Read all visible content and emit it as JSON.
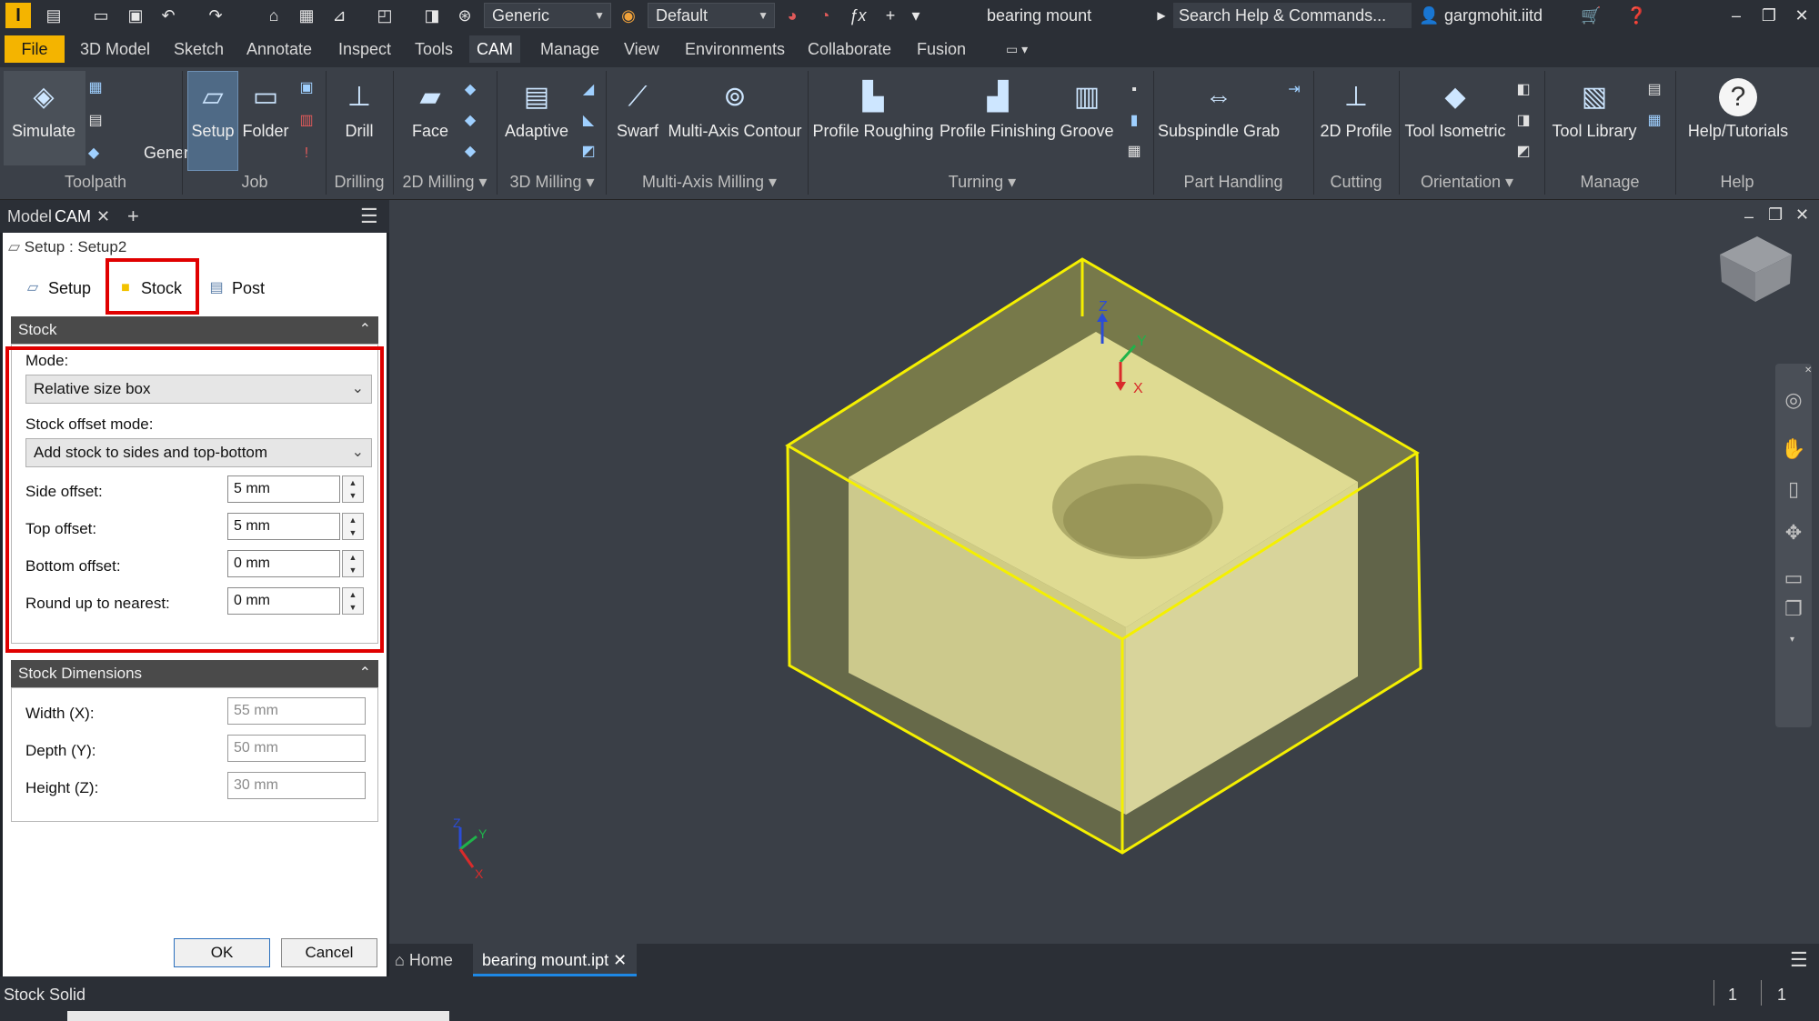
{
  "app": {
    "logo_letter": "I",
    "visual_style": "Generic",
    "appearance": "Default",
    "document_title": "bearing mount",
    "search_placeholder": "Search Help & Commands...",
    "user": "gargmohit.iitd"
  },
  "menu": {
    "file": "File",
    "tabs": [
      "3D Model",
      "Sketch",
      "Annotate",
      "Inspect",
      "Tools",
      "CAM",
      "Manage",
      "View",
      "Environments",
      "Collaborate",
      "Fusion"
    ],
    "active_tab": "CAM"
  },
  "ribbon": {
    "buttons": {
      "simulate": "Simulate",
      "generate": "Generate",
      "setup": "Setup",
      "folder": "Folder",
      "drill": "Drill",
      "face": "Face",
      "adaptive": "Adaptive",
      "swarf": "Swarf",
      "multi_axis_contour": "Multi-Axis Contour",
      "profile_roughing": "Profile Roughing",
      "profile_finishing": "Profile Finishing",
      "groove": "Groove",
      "subspindle_grab": "Subspindle Grab",
      "profile_2d": "2D Profile",
      "tool_isometric": "Tool Isometric",
      "tool_library": "Tool Library",
      "help_tutorials": "Help/Tutorials"
    },
    "groups": {
      "toolpath": "Toolpath",
      "job": "Job",
      "drilling": "Drilling",
      "milling_2d": "2D Milling",
      "milling_3d": "3D Milling",
      "multi_axis": "Multi-Axis Milling",
      "turning": "Turning",
      "part_handling": "Part Handling",
      "cutting": "Cutting",
      "orientation": "Orientation",
      "manage": "Manage",
      "help": "Help"
    }
  },
  "panel": {
    "tab_model": "Model",
    "tab_cam": "CAM"
  },
  "dialog": {
    "title": "Setup : Setup2",
    "tabs": {
      "setup": "Setup",
      "stock": "Stock",
      "post_process": "Post Process"
    },
    "stock_section": {
      "header": "Stock",
      "mode_label": "Mode:",
      "mode_value": "Relative size box",
      "offset_mode_label": "Stock offset mode:",
      "offset_mode_value": "Add stock to sides and top-bottom",
      "side_offset_label": "Side offset:",
      "side_offset_value": "5 mm",
      "top_offset_label": "Top offset:",
      "top_offset_value": "5 mm",
      "bottom_offset_label": "Bottom offset:",
      "bottom_offset_value": "0 mm",
      "round_up_label": "Round up to nearest:",
      "round_up_value": "0 mm"
    },
    "dimensions_section": {
      "header": "Stock Dimensions",
      "width_label": "Width (X):",
      "width_value": "55 mm",
      "depth_label": "Depth (Y):",
      "depth_value": "50 mm",
      "height_label": "Height (Z):",
      "height_value": "30 mm"
    },
    "ok": "OK",
    "cancel": "Cancel"
  },
  "viewport": {
    "axis_x": "X",
    "axis_y": "Y",
    "axis_z": "Z"
  },
  "doc_tabs": {
    "home": "Home",
    "file": "bearing mount.ipt"
  },
  "status": {
    "text": "Stock Solid",
    "count_a": "1",
    "count_b": "1"
  },
  "colors": {
    "stock_outline": "#f5f000",
    "highlight": "#e00000",
    "brand": "#f4b400"
  }
}
